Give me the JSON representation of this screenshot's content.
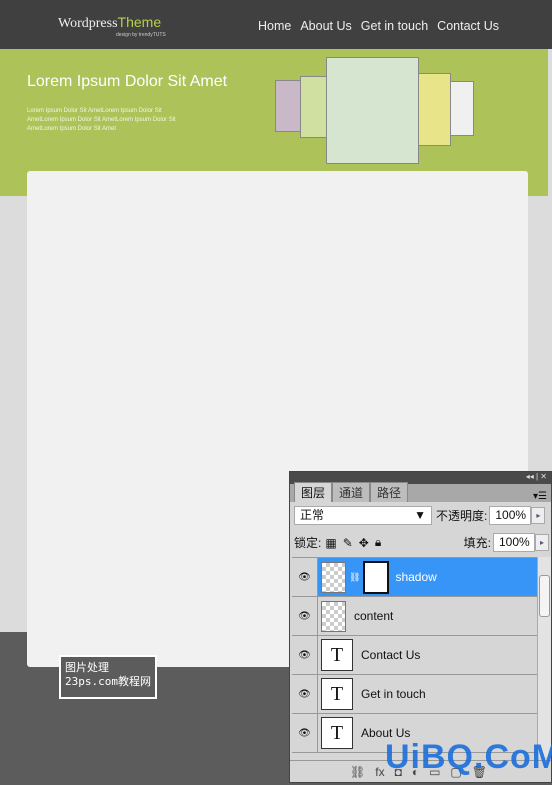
{
  "site": {
    "logo_main": "Wordpress",
    "logo_accent": "Theme",
    "tagline": "design by trendyTUTS",
    "nav": [
      "Home",
      "About Us",
      "Get in touch",
      "Contact Us"
    ],
    "hero_title": "Lorem Ipsum Dolor Sit Amet",
    "hero_text": "Lorem Ipsum Dolor Sit AmetLorem Ipsum Dolor Sit AmetLorem Ipsum Dolor Sit AmetLorem Ipsum Dolor Sit AmetLorem Ipsum Dolor Sit Amet"
  },
  "colors": {
    "header": "#404040",
    "hero": "#adc35a",
    "accent": "#b6d04a",
    "footer": "#5c5c5c",
    "selection": "#3895f8"
  },
  "panel": {
    "tabs": [
      "图层",
      "通道",
      "路径"
    ],
    "blend_mode": "正常",
    "opacity_label": "不透明度:",
    "opacity": "100%",
    "lock_label": "锁定:",
    "fill_label": "填充:",
    "fill": "100%",
    "layers": [
      {
        "name": "shadow",
        "type": "raster-mask",
        "selected": true
      },
      {
        "name": "content",
        "type": "raster"
      },
      {
        "name": "Contact Us",
        "type": "text"
      },
      {
        "name": "Get in touch",
        "type": "text"
      },
      {
        "name": "About Us",
        "type": "text"
      }
    ],
    "text_layer_glyph": "T"
  },
  "watermarks": {
    "stamp_line1": "图片处理",
    "stamp_line2": "23ps.com",
    "stamp_line3": "教程网",
    "brand": "UiBQ.CoM"
  }
}
